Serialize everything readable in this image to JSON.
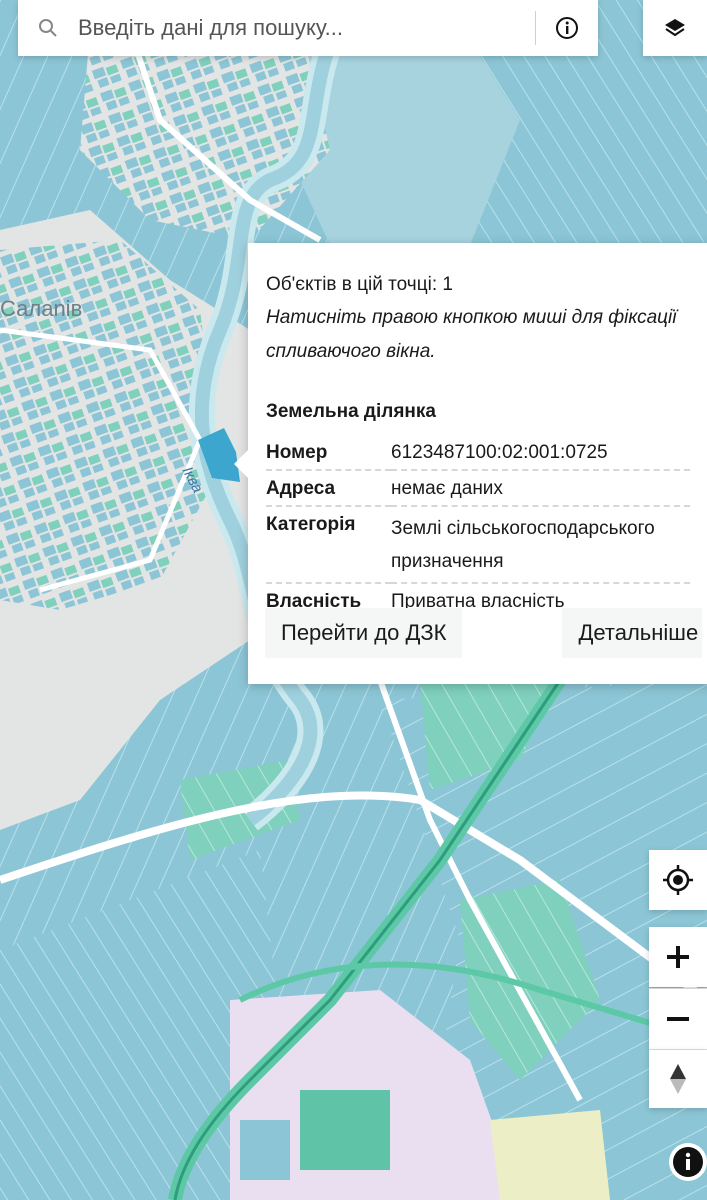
{
  "search": {
    "placeholder": "Введіть дані для пошуку..."
  },
  "map": {
    "labels": {
      "village": "Салаnів",
      "river": "Іква"
    },
    "colors": {
      "water": "#a7d3df",
      "parcel": "#8cc6d6",
      "parcel_green": "#7fd0bd",
      "settlement": "#e3e4e4",
      "industrial": "#eadff0"
    }
  },
  "popup": {
    "count_text": "Об'єктів в цій точці: 1",
    "hint_text": "Натисніть правою кнопкою миші для фіксації спливаючого вікна.",
    "section_title": "Земельна ділянка",
    "attributes": [
      {
        "key": "Номер",
        "value": "6123487100:02:001:0725"
      },
      {
        "key": "Адреса",
        "value": "немає даних"
      },
      {
        "key": "Категорія",
        "value": "Землі сільськогосподарського призначення"
      },
      {
        "key": "Власність",
        "value": "Приватна власність"
      }
    ],
    "buttons": {
      "goto_label": "Перейти до ДЗК",
      "details_label": "Детальніше"
    }
  },
  "controls": {
    "icons": [
      "search-icon",
      "info-icon",
      "layers-icon",
      "locate-icon",
      "plus-icon",
      "minus-icon",
      "compass-icon"
    ]
  }
}
